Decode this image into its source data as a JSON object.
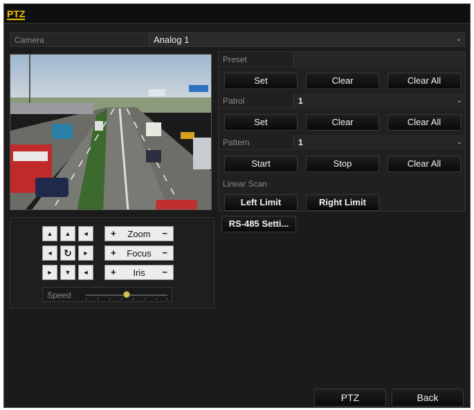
{
  "window": {
    "title": "PTZ"
  },
  "camera": {
    "label": "Camera",
    "value": "Analog 1"
  },
  "preset": {
    "label": "Preset",
    "value": "",
    "set": "Set",
    "clear": "Clear",
    "clear_all": "Clear All"
  },
  "patrol": {
    "label": "Patrol",
    "value": "1",
    "set": "Set",
    "clear": "Clear",
    "clear_all": "Clear All"
  },
  "pattern": {
    "label": "Pattern",
    "value": "1",
    "start": "Start",
    "stop": "Stop",
    "clear_all": "Clear All"
  },
  "linear_scan": {
    "label": "Linear Scan",
    "left_limit": "Left Limit",
    "right_limit": "Right Limit"
  },
  "rs485": {
    "label": "RS-485 Setti..."
  },
  "controls": {
    "zoom": "Zoom",
    "focus": "Focus",
    "iris": "Iris",
    "plus": "+",
    "minus": "−",
    "arrows": {
      "up_left": "▲",
      "up": "▲",
      "up_right": "◄",
      "left": "◄",
      "auto": "↻",
      "right": "►",
      "down_left": "►",
      "down": "▼",
      "down_right": "◄"
    }
  },
  "speed": {
    "label": "Speed",
    "level": 0.5
  },
  "footer": {
    "ptz": "PTZ",
    "back": "Back"
  },
  "icons": {
    "dropdown": "chevron-down-icon",
    "auto_pan": "rotate-icon"
  },
  "colors": {
    "accent": "#f3c400",
    "background": "#1b1b1b",
    "button_light": "#ececec"
  }
}
